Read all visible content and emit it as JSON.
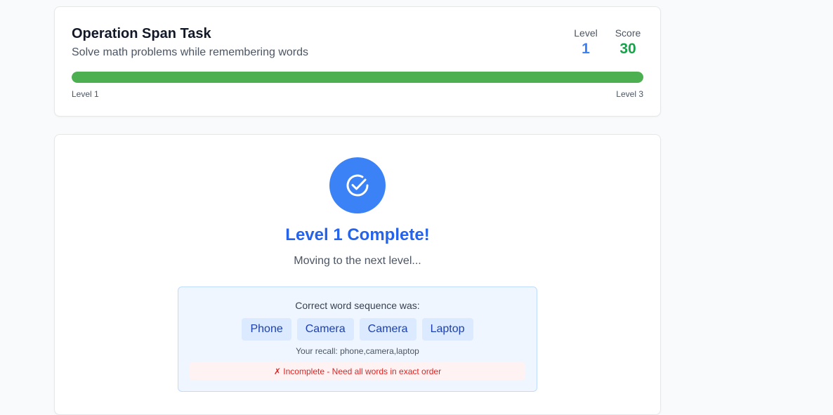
{
  "header": {
    "title": "Operation Span Task",
    "subtitle": "Solve math problems while remembering words",
    "level_label": "Level",
    "level_value": "1",
    "score_label": "Score",
    "score_value": "30",
    "progress_start": "Level 1",
    "progress_end": "Level 3",
    "progress_fraction": 1.0,
    "progress_color": "#4caf50"
  },
  "result": {
    "icon": "check-circle-icon",
    "title": "Level 1 Complete!",
    "message": "Moving to the next level...",
    "sequence_label": "Correct word sequence was:",
    "words": [
      "Phone",
      "Camera",
      "Camera",
      "Laptop"
    ],
    "recall": "Your recall: phone,camera,laptop",
    "status": "✗ Incomplete - Need all words in exact order"
  },
  "colors": {
    "accent": "#3b82f6",
    "score": "#16a34a",
    "error": "#dc2626"
  }
}
